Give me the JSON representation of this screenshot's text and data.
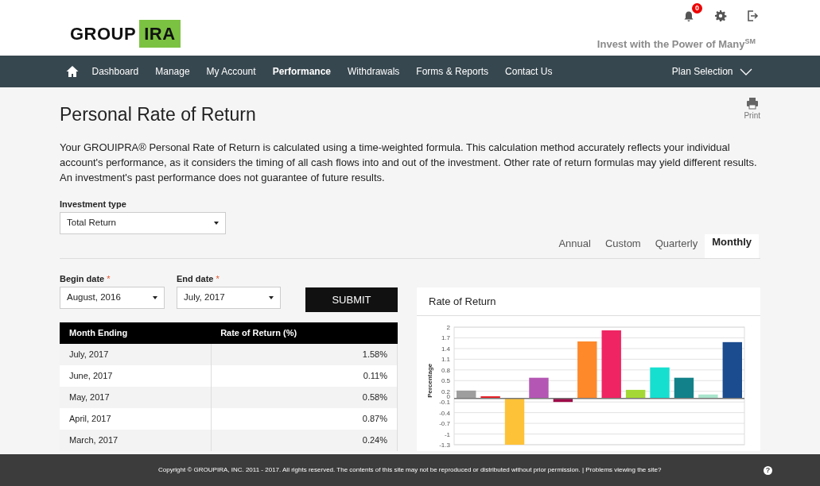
{
  "header": {
    "logo_left": "GROUP",
    "logo_right": "IRA",
    "notification_count": "0",
    "tagline": "Invest with the Power of Many$^{SM}$"
  },
  "nav": {
    "items": [
      {
        "label": "Dashboard",
        "selected": false
      },
      {
        "label": "Manage",
        "selected": false
      },
      {
        "label": "My Account",
        "selected": false
      },
      {
        "label": "Performance",
        "selected": true
      },
      {
        "label": "Withdrawals",
        "selected": false
      },
      {
        "label": "Forms & Reports",
        "selected": false
      },
      {
        "label": "Contact Us",
        "selected": false
      }
    ],
    "plan_selection": "Plan Selection"
  },
  "page": {
    "title": "Personal Rate of Return",
    "print_label": "Print",
    "intro": "Your GROUIPRA® Personal Rate of Return is calculated using a time-weighted formula. This calculation method accurately reflects your individual account's performance, as it considers the timing of all cash flows into and out of the investment. Other rate of return formulas may yield different results. An investment's past performance does not guarantee of future results."
  },
  "investment_type": {
    "label": "Investment type",
    "value": "Total Return"
  },
  "period_tabs": [
    {
      "label": "Annual",
      "selected": false
    },
    {
      "label": "Custom",
      "selected": false
    },
    {
      "label": "Quarterly",
      "selected": false
    },
    {
      "label": "Monthly",
      "selected": true
    }
  ],
  "begin_date": {
    "label": "Begin date",
    "required_mark": "*",
    "value": "August, 2016"
  },
  "end_date": {
    "label": "End date",
    "required_mark": "*",
    "value": "July, 2017"
  },
  "submit_button": "SUBMIT",
  "table": {
    "columns": [
      "Month Ending",
      "Rate of Return (%)"
    ],
    "rows": [
      [
        "July, 2017",
        "1.58%"
      ],
      [
        "June, 2017",
        "0.11%"
      ],
      [
        "May, 2017",
        "0.58%"
      ],
      [
        "April, 2017",
        "0.87%"
      ],
      [
        "March, 2017",
        "0.24%"
      ]
    ]
  },
  "chart": {
    "title": "Rate of Return",
    "bars": [
      {
        "color": "#9e9e9e"
      },
      {
        "color": "#e8222a"
      },
      {
        "color": "#fec238"
      },
      {
        "color": "#b457b4"
      },
      {
        "color": "#9c0b47"
      },
      {
        "color": "#fd892b"
      },
      {
        "color": "#ef2462"
      },
      {
        "color": "#a4d935"
      },
      {
        "color": "#16dfcf"
      },
      {
        "color": "#138189"
      },
      {
        "color": "#a9e5cd"
      },
      {
        "color": "#1b4c8f"
      }
    ],
    "chart_data": {
      "type": "bar",
      "grid": true,
      "ylabel": "Percentage",
      "values": [
        0.22,
        0.06,
        -1.3,
        0.58,
        -0.1,
        1.6,
        1.91,
        0.24,
        0.87,
        0.58,
        0.11,
        1.58
      ],
      "ylim": [
        -1.3,
        2
      ],
      "yticks": [
        2,
        1.7,
        1.4,
        1.1,
        0.8,
        0.5,
        0.2,
        0,
        -0.1,
        -0.4,
        -0.7,
        -1,
        -1.3
      ]
    }
  },
  "footer": {
    "text": "Copyright © GROUPIRA, INC. 2011 - 2017. All rights reserved. The contents of this site may not be reproduced or distributed without prior permission. | Problems viewing the site?",
    "help_icon_label": "?"
  }
}
